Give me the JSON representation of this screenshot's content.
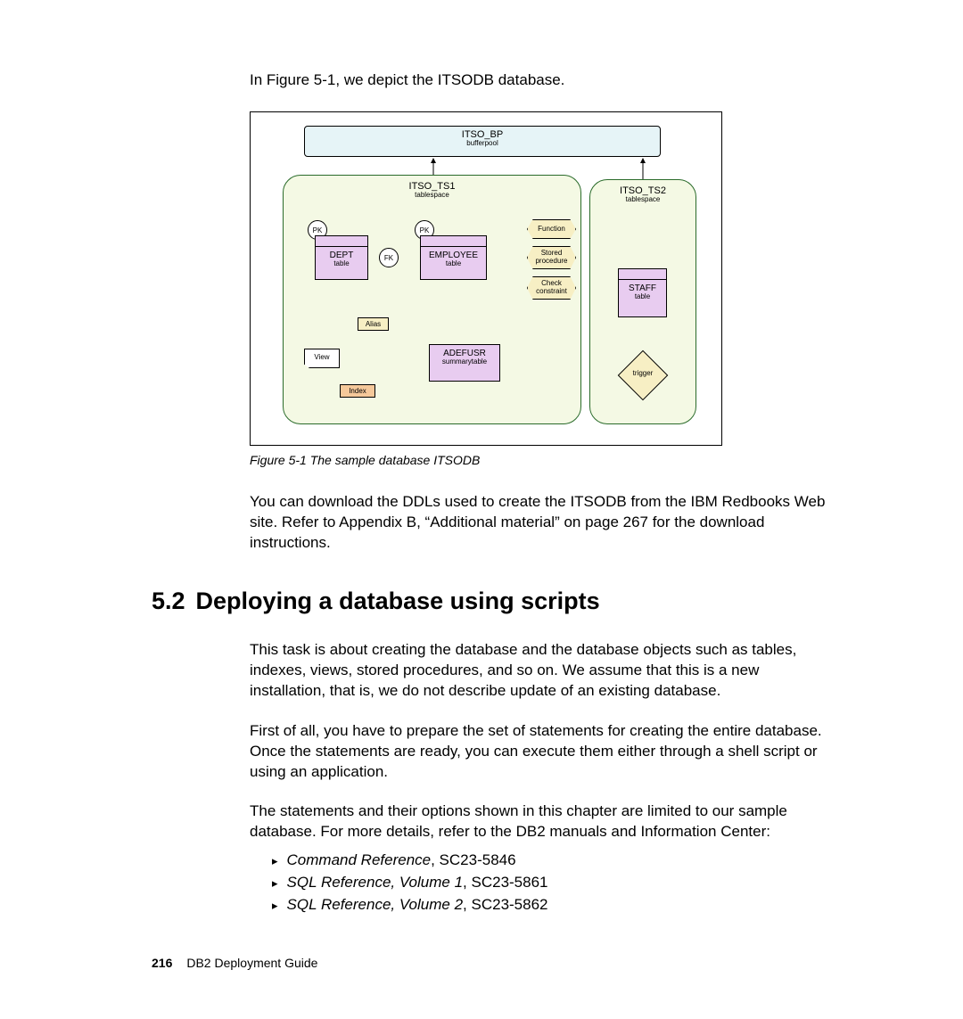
{
  "intro": "In Figure 5-1, we depict the ITSODB database.",
  "diagram": {
    "bp": {
      "name": "ITSO_BP",
      "sub": "bufferpool"
    },
    "ts1": {
      "name": "ITSO_TS1",
      "sub": "tablespace"
    },
    "ts2": {
      "name": "ITSO_TS2",
      "sub": "tablespace"
    },
    "pk": "PK",
    "fk": "FK",
    "dept": {
      "name": "DEPT",
      "sub": "table"
    },
    "emp": {
      "name": "EMPLOYEE",
      "sub": "table"
    },
    "adefusr": {
      "name": "ADEFUSR",
      "sub": "summarytable"
    },
    "staff": {
      "name": "STAFF",
      "sub": "table"
    },
    "alias": "Alias",
    "view": "View",
    "index": "Index",
    "func": "Function",
    "sproc": "Stored procedure",
    "chk": "Check constraint",
    "trigger": "trigger"
  },
  "caption": "Figure 5-1   The sample database ITSODB",
  "para1": "You can download the DDLs used to create the ITSODB from the IBM Redbooks Web site. Refer to Appendix B, “Additional material” on page 267 for the download instructions.",
  "section": {
    "num": "5.2",
    "title": "Deploying a database using scripts"
  },
  "para2": "This task is about creating the database and the database objects such as tables, indexes, views, stored procedures, and so on. We assume that this is a new installation, that is, we do not describe update of an existing database.",
  "para3": "First of all, you have to prepare the set of statements for creating the entire database. Once the statements are ready, you can execute them either through a shell script or using an application.",
  "para4": "The statements and their options shown in this chapter are limited to our sample database. For more details, refer to the DB2 manuals and Information Center:",
  "refs": [
    {
      "title": "Command Reference",
      "code": ", SC23-5846"
    },
    {
      "title": "SQL Reference, Volume 1",
      "code": ", SC23-5861"
    },
    {
      "title": "SQL Reference, Volume 2",
      "code": ", SC23-5862"
    }
  ],
  "footer": {
    "page": "216",
    "book": "DB2 Deployment Guide"
  }
}
